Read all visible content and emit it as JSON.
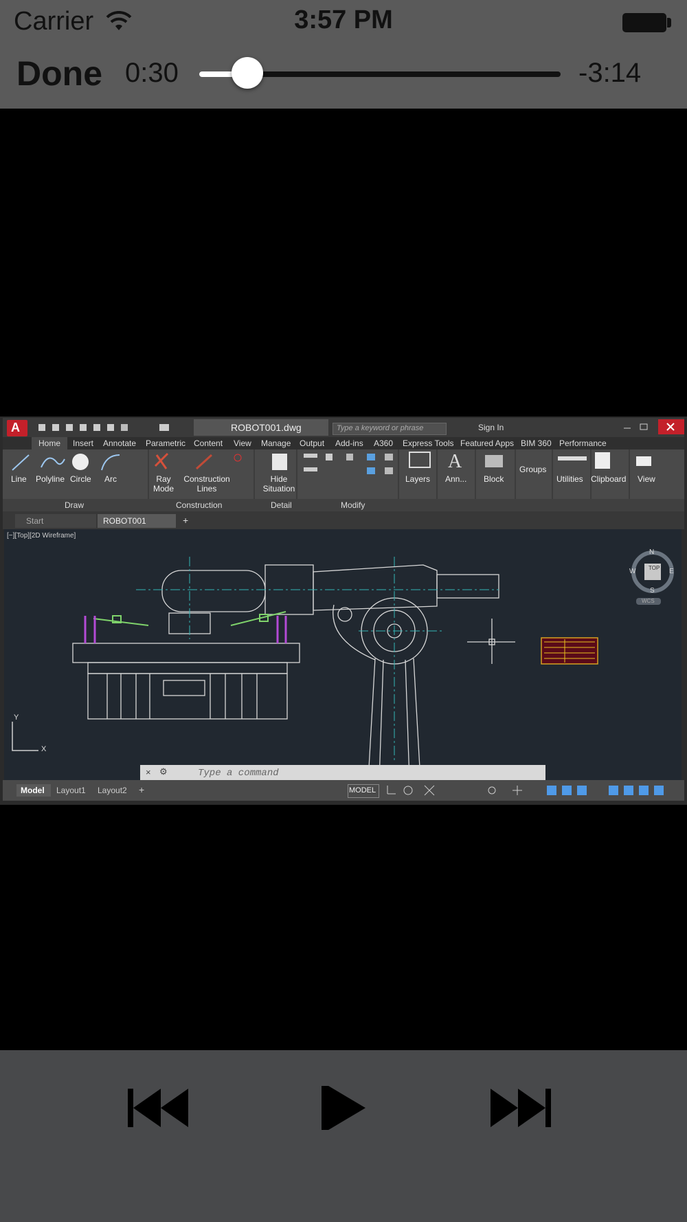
{
  "status_bar": {
    "carrier": "Carrier",
    "time": "3:57 PM"
  },
  "player": {
    "done_label": "Done",
    "elapsed": "0:30",
    "remaining": "-3:14",
    "progress": 0.134
  },
  "video": {
    "app_title": "ROBOT001.dwg",
    "search_placeholder": "Type a keyword or phrase",
    "sign_in": "Sign In",
    "ribbon_tabs": [
      "Home",
      "Insert",
      "Annotate",
      "Parametric",
      "Content",
      "View",
      "Manage",
      "Output",
      "Add-ins",
      "A360",
      "Express Tools",
      "Featured Apps",
      "BIM 360",
      "Performance"
    ],
    "ribbon_tools": [
      "Line",
      "Polyline",
      "Circle",
      "Arc",
      "Ray Mode",
      "Construction Lines",
      "Hide Situation",
      "Layers",
      "Ann...",
      "Block",
      "Groups",
      "Utilities",
      "Clipboard",
      "View"
    ],
    "ribbon_groups": [
      "Draw",
      "Construction",
      "Detail",
      "Modify"
    ],
    "doc_tabs": [
      "Start",
      "ROBOT001"
    ],
    "viewport_label": "[−][Top][2D Wireframe]",
    "viewcube": {
      "top": "TOP",
      "n": "N",
      "s": "S",
      "e": "E",
      "w": "W",
      "wcs": "WCS"
    },
    "ucs": {
      "x": "X",
      "y": "Y"
    },
    "command_placeholder": "Type a command",
    "layout_tabs": [
      "Model",
      "Layout1",
      "Layout2"
    ],
    "status_model": "MODEL"
  },
  "controls": {
    "previous": "previous-track",
    "play": "play",
    "next": "next-track"
  },
  "colors": {
    "bar": "#5a5a5a",
    "bottom_bar": "#48494b",
    "canvas": "#212830"
  }
}
